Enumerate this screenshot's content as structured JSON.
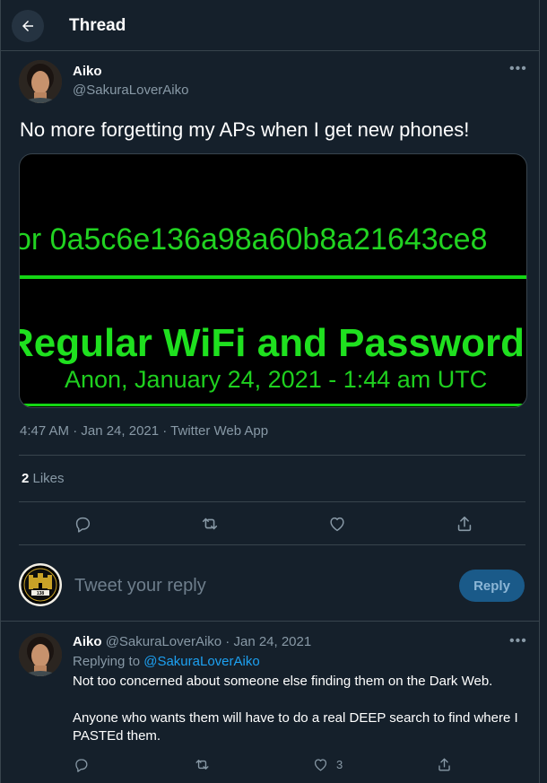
{
  "header": {
    "title": "Thread"
  },
  "tweet": {
    "name": "Aiko",
    "handle": "@SakuraLoverAiko",
    "text": "No more forgetting my APs when I get new phones!",
    "media": {
      "hex_line": "or 0a5c6e136a98a60b8a21643ce8",
      "headline": "Regular WiFi and Password",
      "byline": "Anon, January 24, 2021 - 1:44 am UTC"
    },
    "meta": "4:47 AM · Jan 24, 2021 · Twitter Web App",
    "likes_count": "2",
    "likes_label": " Likes"
  },
  "composer": {
    "placeholder": "Tweet your reply",
    "button": "Reply",
    "avatar_badge": "138"
  },
  "reply": {
    "name": "Aiko",
    "handle_date": "@SakuraLoverAiko · Jan 24, 2021",
    "replying_prefix": "Replying to ",
    "replying_handle": "@SakuraLoverAiko",
    "line1": "Not too concerned about someone else finding them on the Dark Web.",
    "line2": "Anyone who wants them will have to do a real DEEP search to find where I",
    "line3": "PASTEd them.",
    "like_count": "3"
  },
  "icons": [
    "back-arrow-icon",
    "more-icon",
    "comment-icon",
    "retweet-icon",
    "like-icon",
    "share-icon"
  ],
  "colors": {
    "background": "#15202b",
    "accent": "#1da1f2",
    "muted": "#8899a6",
    "divider": "#38444d",
    "terminal_green": "#21d321"
  }
}
